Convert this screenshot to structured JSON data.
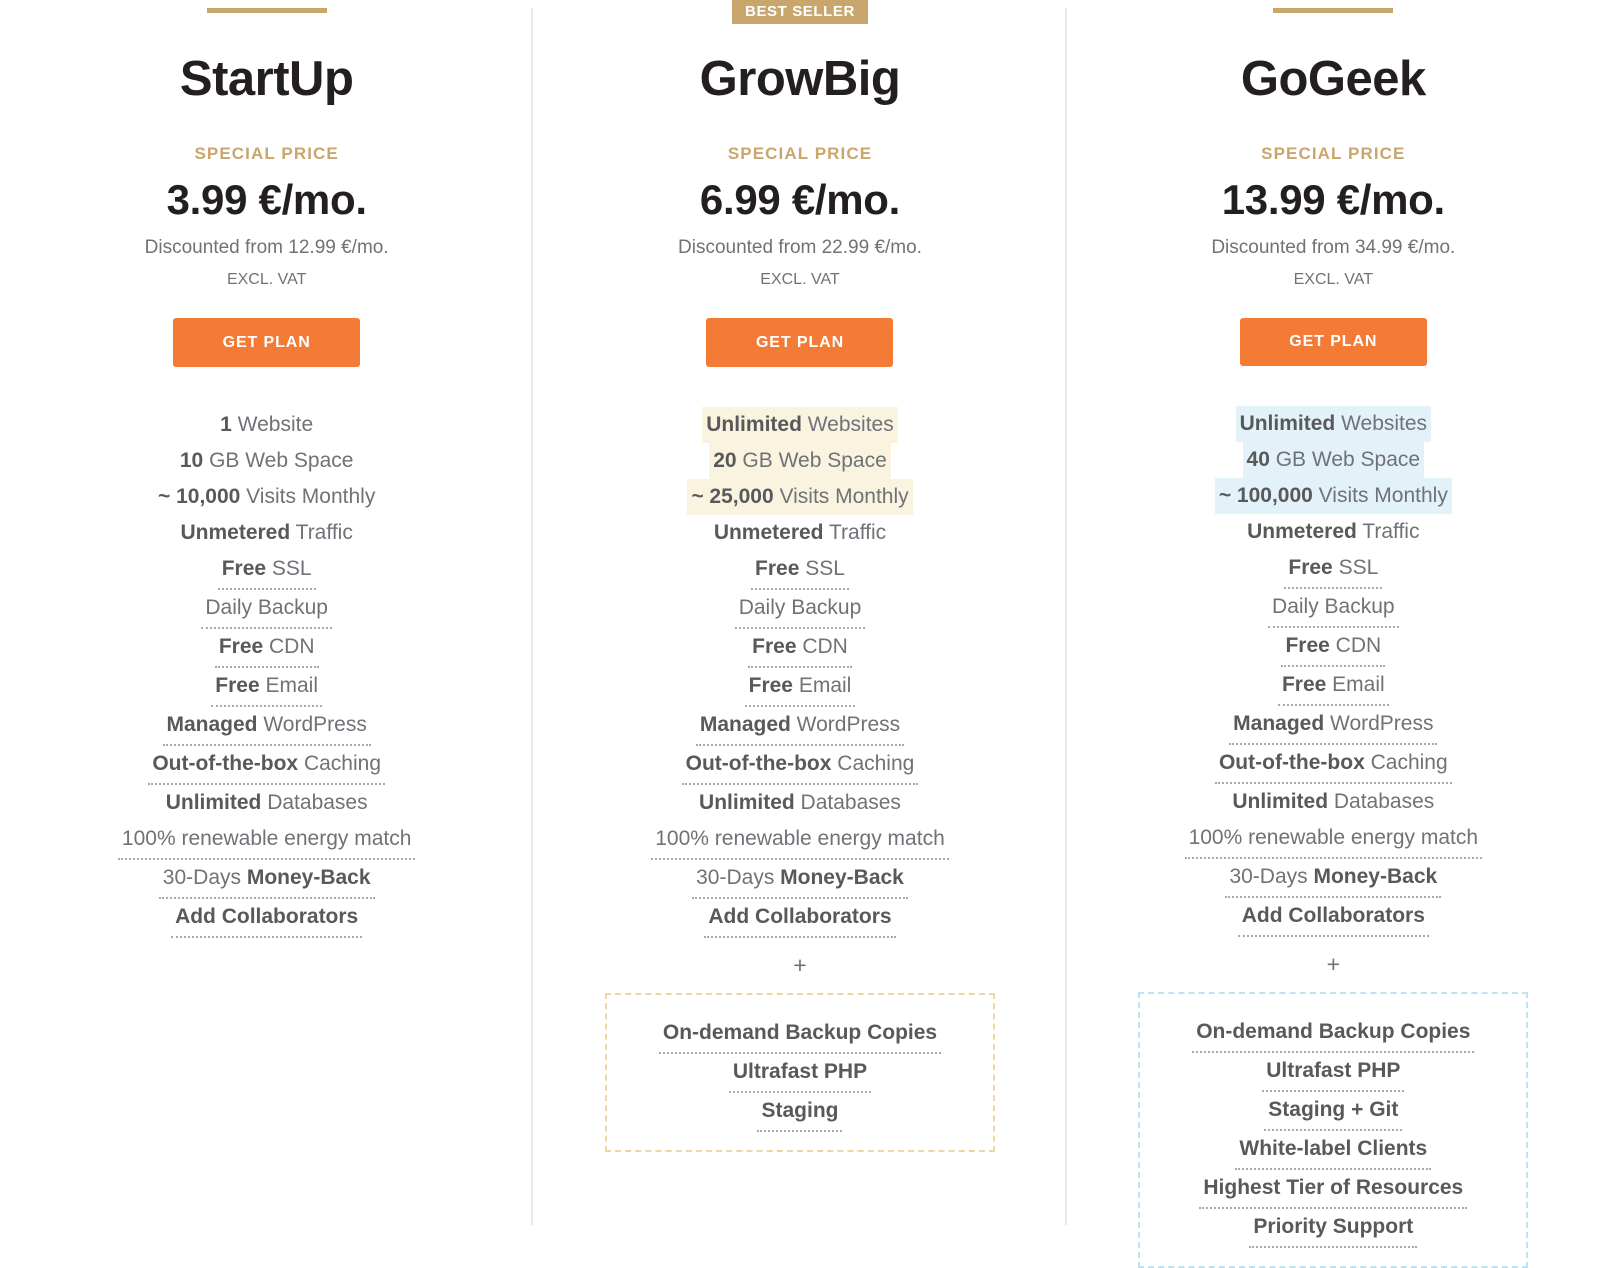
{
  "theme": {
    "gold": "#c9a66b",
    "orange_cta": "#f47b35",
    "highlight_gold": "#f9f3e0",
    "highlight_blue": "#e3f1f8",
    "dashed_gold": "#ecd9a0",
    "dashed_blue": "#bfe2ef",
    "text_dark": "#231f20",
    "text_body": "#6f7276"
  },
  "plans": [
    {
      "id": "startup",
      "name": "StartUp",
      "badge": null,
      "marker": "gold-bar",
      "special_price_label": "SPECIAL PRICE",
      "price": "3.99 €/mo.",
      "discounted_from": "Discounted from 12.99 €/mo.",
      "vat_note": "EXCL. VAT",
      "cta_label": "GET PLAN",
      "features": [
        {
          "strong": "1",
          "rest": " Website",
          "dotted": false,
          "highlight": null
        },
        {
          "strong": "10",
          "rest": " GB Web Space",
          "dotted": false,
          "highlight": null
        },
        {
          "strong": "~ 10,000",
          "rest": " Visits Monthly",
          "dotted": false,
          "highlight": null
        },
        {
          "strong": "Unmetered",
          "rest": " Traffic",
          "dotted": false,
          "highlight": null
        },
        {
          "strong": "Free",
          "rest": " SSL",
          "dotted": true,
          "highlight": null
        },
        {
          "strong": "",
          "rest": "Daily Backup",
          "dotted": true,
          "highlight": null
        },
        {
          "strong": "Free",
          "rest": " CDN",
          "dotted": true,
          "highlight": null
        },
        {
          "strong": "Free",
          "rest": " Email",
          "dotted": true,
          "highlight": null
        },
        {
          "strong": "Managed",
          "rest": " WordPress",
          "dotted": true,
          "highlight": null
        },
        {
          "strong": "Out-of-the-box",
          "rest": " Caching",
          "dotted": true,
          "highlight": null
        },
        {
          "strong": "Unlimited",
          "rest": " Databases",
          "dotted": false,
          "highlight": null
        },
        {
          "strong": "",
          "rest": "100% renewable energy match",
          "dotted": true,
          "highlight": null
        },
        {
          "strong": "",
          "rest": "30-Days ",
          "strong_after": "Money-Back",
          "dotted": true,
          "highlight": null
        },
        {
          "strong": "Add Collaborators",
          "rest": "",
          "dotted": true,
          "highlight": null
        }
      ],
      "plus_separator": null,
      "extras": null
    },
    {
      "id": "growbig",
      "name": "GrowBig",
      "badge": "BEST SELLER",
      "marker": "badge",
      "special_price_label": "SPECIAL PRICE",
      "price": "6.99 €/mo.",
      "discounted_from": "Discounted from 22.99 €/mo.",
      "vat_note": "EXCL. VAT",
      "cta_label": "GET PLAN",
      "features": [
        {
          "strong": "Unlimited",
          "rest": " Websites",
          "dotted": false,
          "highlight": "gold"
        },
        {
          "strong": "20",
          "rest": " GB Web Space",
          "dotted": false,
          "highlight": "gold"
        },
        {
          "strong": "~ 25,000",
          "rest": " Visits Monthly",
          "dotted": false,
          "highlight": "gold"
        },
        {
          "strong": "Unmetered",
          "rest": " Traffic",
          "dotted": false,
          "highlight": null
        },
        {
          "strong": "Free",
          "rest": " SSL",
          "dotted": true,
          "highlight": null
        },
        {
          "strong": "",
          "rest": "Daily Backup",
          "dotted": true,
          "highlight": null
        },
        {
          "strong": "Free",
          "rest": " CDN",
          "dotted": true,
          "highlight": null
        },
        {
          "strong": "Free",
          "rest": " Email",
          "dotted": true,
          "highlight": null
        },
        {
          "strong": "Managed",
          "rest": " WordPress",
          "dotted": true,
          "highlight": null
        },
        {
          "strong": "Out-of-the-box",
          "rest": " Caching",
          "dotted": true,
          "highlight": null
        },
        {
          "strong": "Unlimited",
          "rest": " Databases",
          "dotted": false,
          "highlight": null
        },
        {
          "strong": "",
          "rest": "100% renewable energy match",
          "dotted": true,
          "highlight": null
        },
        {
          "strong": "",
          "rest": "30-Days ",
          "strong_after": "Money-Back",
          "dotted": true,
          "highlight": null
        },
        {
          "strong": "Add Collaborators",
          "rest": "",
          "dotted": true,
          "highlight": null
        }
      ],
      "plus_separator": "+",
      "extras": {
        "style": "gold",
        "items": [
          {
            "label": "On-demand Backup Copies",
            "dotted": true
          },
          {
            "label": "Ultrafast PHP",
            "dotted": true
          },
          {
            "label": "Staging",
            "dotted": true
          }
        ]
      }
    },
    {
      "id": "gogeek",
      "name": "GoGeek",
      "badge": null,
      "marker": "gold-bar",
      "special_price_label": "SPECIAL PRICE",
      "price": "13.99 €/mo.",
      "discounted_from": "Discounted from 34.99 €/mo.",
      "vat_note": "EXCL. VAT",
      "cta_label": "GET PLAN",
      "features": [
        {
          "strong": "Unlimited",
          "rest": " Websites",
          "dotted": false,
          "highlight": "blue"
        },
        {
          "strong": "40",
          "rest": " GB Web Space",
          "dotted": false,
          "highlight": "blue"
        },
        {
          "strong": "~ 100,000",
          "rest": " Visits Monthly",
          "dotted": false,
          "highlight": "blue"
        },
        {
          "strong": "Unmetered",
          "rest": " Traffic",
          "dotted": false,
          "highlight": null
        },
        {
          "strong": "Free",
          "rest": " SSL",
          "dotted": true,
          "highlight": null
        },
        {
          "strong": "",
          "rest": "Daily Backup",
          "dotted": true,
          "highlight": null
        },
        {
          "strong": "Free",
          "rest": " CDN",
          "dotted": true,
          "highlight": null
        },
        {
          "strong": "Free",
          "rest": " Email",
          "dotted": true,
          "highlight": null
        },
        {
          "strong": "Managed",
          "rest": " WordPress",
          "dotted": true,
          "highlight": null
        },
        {
          "strong": "Out-of-the-box",
          "rest": " Caching",
          "dotted": true,
          "highlight": null
        },
        {
          "strong": "Unlimited",
          "rest": " Databases",
          "dotted": false,
          "highlight": null
        },
        {
          "strong": "",
          "rest": "100% renewable energy match",
          "dotted": true,
          "highlight": null
        },
        {
          "strong": "",
          "rest": "30-Days ",
          "strong_after": "Money-Back",
          "dotted": true,
          "highlight": null
        },
        {
          "strong": "Add Collaborators",
          "rest": "",
          "dotted": true,
          "highlight": null
        }
      ],
      "plus_separator": "+",
      "extras": {
        "style": "blue",
        "items": [
          {
            "label": "On-demand Backup Copies",
            "dotted": true
          },
          {
            "label": "Ultrafast PHP",
            "dotted": true
          },
          {
            "label": "Staging + Git",
            "dotted": true
          },
          {
            "label": "White-label Clients",
            "dotted": true
          },
          {
            "label": "Highest Tier of Resources",
            "dotted": true
          },
          {
            "label": "Priority Support",
            "dotted": true
          }
        ]
      }
    }
  ]
}
